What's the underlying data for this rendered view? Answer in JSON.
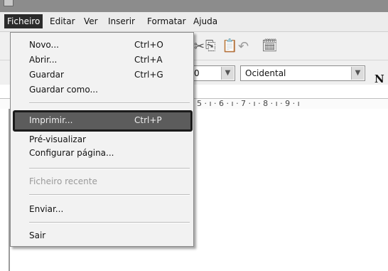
{
  "menubar": {
    "items": [
      "Ficheiro",
      "Editar",
      "Ver",
      "Inserir",
      "Formatar",
      "Ajuda"
    ]
  },
  "toolbar": {
    "font_size": "0",
    "script": "Ocidental",
    "bold_label": "N"
  },
  "ruler": {
    "text": "· 5 · ı · 6 · ı · 7 · ı · 8 · ı · 9 · ı"
  },
  "file_menu": {
    "items": [
      {
        "label": "Novo...",
        "shortcut": "Ctrl+O"
      },
      {
        "label": "Abrir...",
        "shortcut": "Ctrl+A"
      },
      {
        "label": "Guardar",
        "shortcut": "Ctrl+G"
      },
      {
        "label": "Guardar como...",
        "shortcut": ""
      },
      {
        "label": "Imprimir...",
        "shortcut": "Ctrl+P"
      },
      {
        "label": "Pré-visualizar",
        "shortcut": ""
      },
      {
        "label": "Configurar página...",
        "shortcut": ""
      },
      {
        "label": "Ficheiro recente",
        "shortcut": ""
      },
      {
        "label": "Enviar...",
        "shortcut": ""
      },
      {
        "label": "Sair",
        "shortcut": ""
      }
    ]
  }
}
